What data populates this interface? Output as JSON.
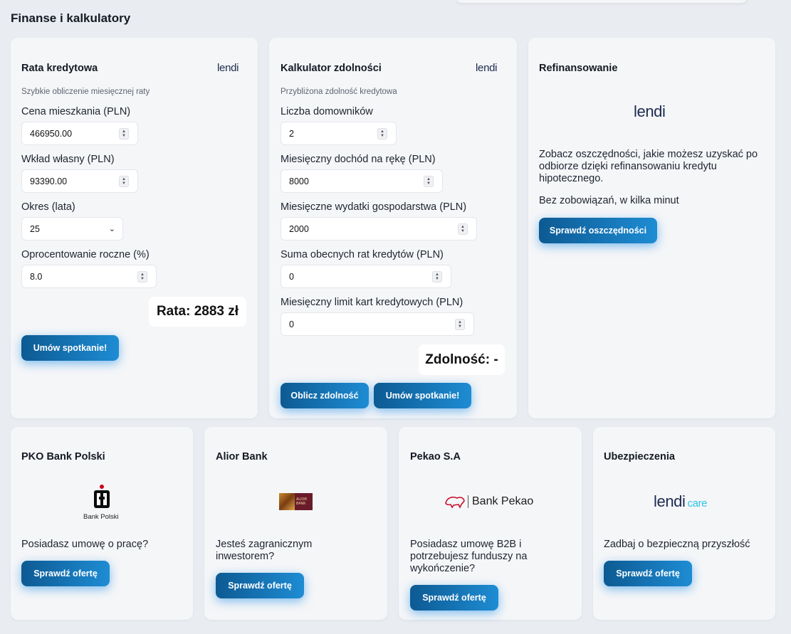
{
  "page": {
    "title": "Finanse i kalkulatory"
  },
  "rata": {
    "title": "Rata kredytowa",
    "brand": "lendi",
    "subtitle": "Szybkie obliczenie miesięcznej raty",
    "fields": [
      {
        "label": "Cena mieszkania (PLN)",
        "value": "466950.00"
      },
      {
        "label": "Wkład własny (PLN)",
        "value": "93390.00"
      },
      {
        "label": "Okres (lata)",
        "value": "25"
      },
      {
        "label": "Oprocentowanie roczne (%)",
        "value": "8.0"
      }
    ],
    "result": "Rata: 2883 zł",
    "button": "Umów spotkanie!"
  },
  "zdolnosc": {
    "title": "Kalkulator zdolności",
    "brand": "lendi",
    "subtitle": "Przybliżona zdolność kredytowa",
    "fields": [
      {
        "label": "Liczba domowników",
        "value": "2"
      },
      {
        "label": "Miesięczny dochód na rękę (PLN)",
        "value": "8000"
      },
      {
        "label": "Miesięczne wydatki gospodarstwa (PLN)",
        "value": "2000"
      },
      {
        "label": "Suma obecnych rat kredytów (PLN)",
        "value": "0"
      },
      {
        "label": "Miesięczny limit kart kredytowych (PLN)",
        "value": "0"
      }
    ],
    "result": "Zdolność: -",
    "button_calc": "Oblicz zdolność",
    "button_meet": "Umów spotkanie!"
  },
  "refi": {
    "title": "Refinansowanie",
    "brand": "lendi",
    "text": "Zobacz oszczędności, jakie możesz uzyskać po odbiorze dzięki refinansowaniu kredytu hipotecznego.",
    "text2": "Bez zobowiązań, w kilka minut",
    "button": "Sprawdź oszczędności"
  },
  "pko": {
    "title": "PKO Bank Polski",
    "logo_text": "Bank Polski",
    "text": "Posiadasz umowę o pracę?",
    "button": "Sprawdź ofertę"
  },
  "alior": {
    "title": "Alior Bank",
    "logo_text": "ALIOR BANK",
    "text": "Jesteś zagranicznym inwestorem?",
    "button": "Sprawdź ofertę"
  },
  "pekao": {
    "title": "Pekao S.A",
    "logo_text": "Bank Pekao",
    "text": "Posiadasz umowę B2B i potrzebujesz funduszy na wykończenie?",
    "button": "Sprawdź ofertę"
  },
  "insurance": {
    "title": "Ubezpieczenia",
    "logo_main": "lendi",
    "logo_sub": "care",
    "text": "Zadbaj o bezpieczną przyszłość",
    "button": "Sprawdź ofertę"
  },
  "colors": {
    "button_start": "#0d5a93",
    "button_end": "#1e8cd3",
    "lendi_navy": "#1b2a4e",
    "care_cyan": "#2ec4e8",
    "pko_red": "#d0021b",
    "pekao_red": "#c8102e",
    "alior_maroon": "#6a1b2a"
  }
}
